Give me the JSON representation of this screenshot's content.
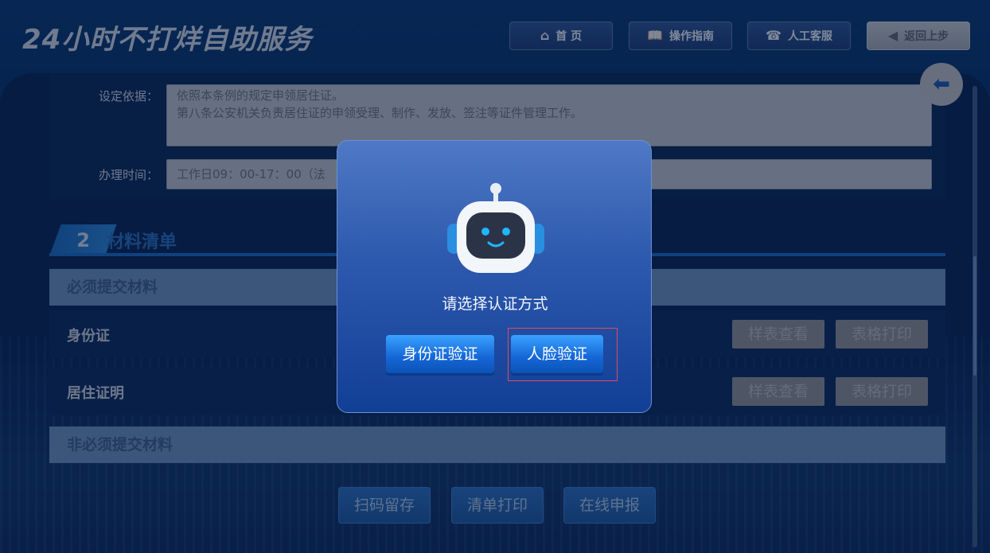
{
  "header": {
    "title": "24小时不打烊自助服务",
    "nav": [
      {
        "label": "首 页",
        "icon": "home-icon",
        "symbol": "⌂"
      },
      {
        "label": "操作指南",
        "icon": "book-icon",
        "symbol": "📖"
      },
      {
        "label": "人工客服",
        "icon": "headset-icon",
        "symbol": "☎"
      },
      {
        "label": "返回上步",
        "icon": "arrow-left-icon",
        "symbol": "◀"
      }
    ]
  },
  "info": {
    "basis_label": "设定依据：",
    "basis_text_line1": "依照本条例的规定申领居住证。",
    "basis_text_line2": "第八条公安机关负责居住证的申领受理、制作、发放、签注等证件管理工作。",
    "time_label": "办理时间：",
    "time_text": "工作日09：00-17：00（法"
  },
  "materials": {
    "number": "2",
    "title": "材料清单",
    "required_heading": "必须提交材料",
    "optional_heading": "非必须提交材料",
    "items": [
      {
        "name": "身份证",
        "view": "样表查看",
        "print": "表格打印"
      },
      {
        "name": "居住证明",
        "view": "样表查看",
        "print": "表格打印"
      }
    ]
  },
  "footer_buttons": [
    "扫码留存",
    "清单打印",
    "在线申报"
  ],
  "modal": {
    "title": "请选择认证方式",
    "id_button": "身份证验证",
    "face_button": "人脸验证"
  }
}
